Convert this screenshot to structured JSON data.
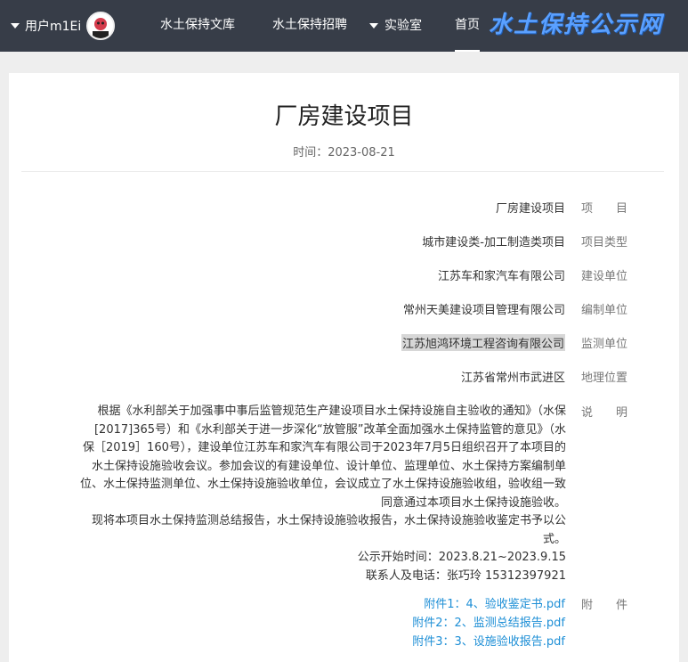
{
  "header": {
    "logo": "水土保持公示网",
    "user_name": "用户m1Ei",
    "nav": {
      "home": "首页",
      "lab": "实验室",
      "jobs": "水土保持招聘",
      "library": "水土保持文库"
    },
    "colors": {
      "bar": "#373d48",
      "logo": "#5aa0ff"
    }
  },
  "article": {
    "title": "厂房建设项目",
    "date": "时间：2023-08-21",
    "fields": [
      {
        "label": "项　　目",
        "value": "厂房建设项目"
      },
      {
        "label": "项目类型",
        "value": "城市建设类-加工制造类项目"
      },
      {
        "label": "建设单位",
        "value": "江苏车和家汽车有限公司"
      },
      {
        "label": "编制单位",
        "value": "常州天美建设项目管理有限公司"
      },
      {
        "label": "监测单位",
        "value": "江苏旭鸿环境工程咨询有限公司"
      },
      {
        "label": "地理位置",
        "value": "江苏省常州市武进区"
      }
    ],
    "description_label": "说　　明",
    "description": [
      "根据《水利部关于加强事中事后监管规范生产建设项目水土保持设施自主验收的通知》（水保",
      "[2017]365号）和《水利部关于进一步深化“放管服”改革全面加强水土保持监管的意见》（水",
      "保［2019］160号），建设单位江苏车和家汽车有限公司于2023年7月5日组织召开了本项目的",
      "水土保持设施验收会议。参加会议的有建设单位、设计单位、监理单位、水土保持方案编制单",
      "位、水土保持监测单位、水土保持设施验收单位，会议成立了水土保持设施验收组，验收组一致",
      "同意通过本项目水土保持设施验收。",
      "现将本项目水土保持监测总结报告，水土保持设施验收报告，水土保持设施验收鉴定书予以公",
      "式。",
      "公示开始时间：2023.8.21~2023.9.15",
      "联系人及电话：张巧玲 15312397921"
    ],
    "attachments_label": "附　　件",
    "attachments": [
      "附件1：4、验收鉴定书.pdf",
      "附件2：2、监测总结报告.pdf",
      "附件3：3、设施验收报告.pdf"
    ]
  }
}
